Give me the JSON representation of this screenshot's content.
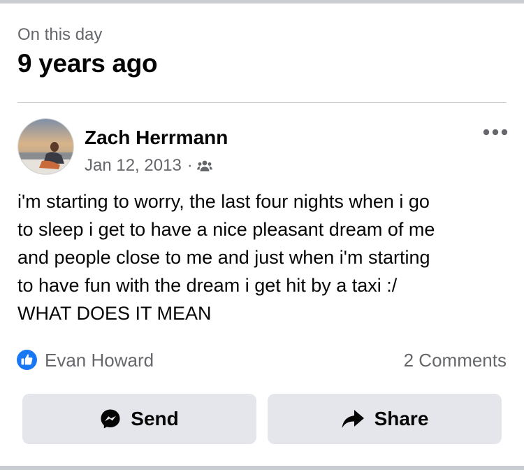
{
  "memory": {
    "label": "On this day",
    "title": "9 years ago"
  },
  "post": {
    "author": "Zach Herrmann",
    "date": "Jan 12, 2013",
    "separator": "·",
    "audience_icon": "friends-icon",
    "text": "i'm starting to worry, the last four nights when i go\nto sleep i get to have a nice pleasant dream of me\nand people close to me and just when i'm starting\nto have fun with the dream i get hit by a taxi :/\nWHAT DOES IT MEAN"
  },
  "reactions": {
    "icon": "like-icon",
    "names": "Evan Howard",
    "comments": "2 Comments"
  },
  "actions": {
    "send": {
      "label": "Send",
      "icon": "messenger-icon"
    },
    "share": {
      "label": "Share",
      "icon": "share-arrow-icon"
    }
  },
  "colors": {
    "like_blue": "#1877f2",
    "secondary_text": "#65676b",
    "button_bg": "#e4e6eb"
  }
}
